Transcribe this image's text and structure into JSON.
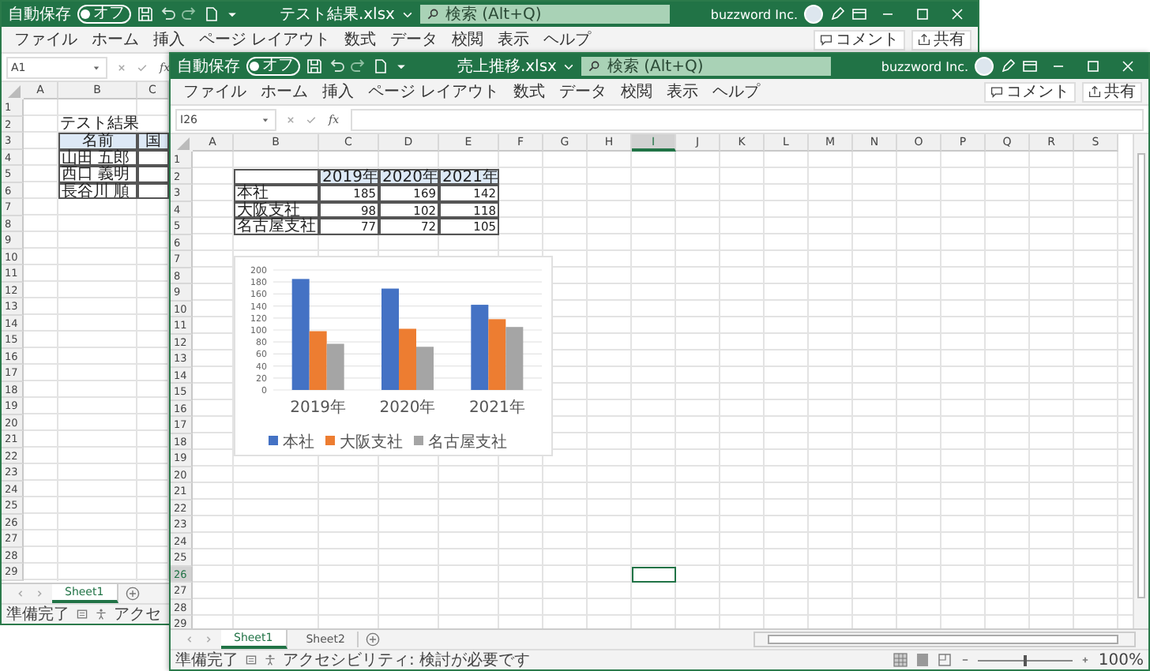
{
  "windows": [
    {
      "autosave": {
        "label": "自動保存",
        "toggle": "オフ",
        "on": false
      },
      "title": "テスト結果.xlsx",
      "search": {
        "placeholder": "検索 (Alt+Q)"
      },
      "account": "buzzword Inc.",
      "ribbon_tabs": [
        "ファイル",
        "ホーム",
        "挿入",
        "ページ レイアウト",
        "数式",
        "データ",
        "校閲",
        "表示",
        "ヘルプ"
      ],
      "comment_button": "コメント",
      "share_button": "共有",
      "name_box": "A1",
      "formula_label": "fx",
      "columns": [
        "A",
        "B",
        "C"
      ],
      "rows": [
        {
          "number": "1"
        },
        {
          "number": "2"
        },
        {
          "number": "3"
        },
        {
          "number": "4"
        },
        {
          "number": "5"
        },
        {
          "number": "6"
        },
        {
          "number": "7"
        },
        {
          "number": "8"
        },
        {
          "number": "9"
        },
        {
          "number": "10"
        },
        {
          "number": "11"
        },
        {
          "number": "12"
        },
        {
          "number": "13"
        },
        {
          "number": "14"
        },
        {
          "number": "15"
        },
        {
          "number": "16"
        },
        {
          "number": "17"
        },
        {
          "number": "18"
        },
        {
          "number": "19"
        },
        {
          "number": "20"
        },
        {
          "number": "21"
        },
        {
          "number": "22"
        },
        {
          "number": "23"
        },
        {
          "number": "24"
        },
        {
          "number": "25"
        },
        {
          "number": "26"
        },
        {
          "number": "27"
        },
        {
          "number": "28"
        },
        {
          "number": "29"
        }
      ],
      "sheet_title": "テスト結果",
      "table": {
        "columns": [
          "名前",
          "国"
        ],
        "rows": [
          {
            "label": "山田 五郎"
          },
          {
            "label": "西口 義明"
          },
          {
            "label": "長谷川 順"
          }
        ]
      },
      "sheet_tabs": [
        {
          "label": "Sheet1",
          "selected": true
        }
      ],
      "status_bar": {
        "ready": "準備完了",
        "accessibility": "アクセ"
      }
    },
    {
      "autosave": {
        "label": "自動保存",
        "toggle": "オフ",
        "on": false
      },
      "title": "売上推移.xlsx",
      "search": {
        "placeholder": "検索 (Alt+Q)"
      },
      "account": "buzzword Inc.",
      "ribbon_tabs": [
        "ファイル",
        "ホーム",
        "挿入",
        "ページ レイアウト",
        "数式",
        "データ",
        "校閲",
        "表示",
        "ヘルプ"
      ],
      "comment_button": "コメント",
      "share_button": "共有",
      "name_box": "I26",
      "formula_label": "fx",
      "columns": [
        {
          "label": "A",
          "selected": false
        },
        {
          "label": "B",
          "selected": false
        },
        {
          "label": "C",
          "selected": false
        },
        {
          "label": "D",
          "selected": false
        },
        {
          "label": "E",
          "selected": false
        },
        {
          "label": "F",
          "selected": false
        },
        {
          "label": "G",
          "selected": false
        },
        {
          "label": "H",
          "selected": false
        },
        {
          "label": "I",
          "selected": true
        },
        {
          "label": "J",
          "selected": false
        },
        {
          "label": "K",
          "selected": false
        },
        {
          "label": "L",
          "selected": false
        },
        {
          "label": "M",
          "selected": false
        },
        {
          "label": "N",
          "selected": false
        },
        {
          "label": "O",
          "selected": false
        },
        {
          "label": "P",
          "selected": false
        },
        {
          "label": "Q",
          "selected": false
        },
        {
          "label": "R",
          "selected": false
        },
        {
          "label": "S",
          "selected": false
        }
      ],
      "rows": [
        {
          "number": "1",
          "selected": false
        },
        {
          "number": "2",
          "selected": false
        },
        {
          "number": "3",
          "selected": false
        },
        {
          "number": "4",
          "selected": false
        },
        {
          "number": "5",
          "selected": false
        },
        {
          "number": "6",
          "selected": false
        },
        {
          "number": "7",
          "selected": false
        },
        {
          "number": "8",
          "selected": false
        },
        {
          "number": "9",
          "selected": false
        },
        {
          "number": "10",
          "selected": false
        },
        {
          "number": "11",
          "selected": false
        },
        {
          "number": "12",
          "selected": false
        },
        {
          "number": "13",
          "selected": false
        },
        {
          "number": "14",
          "selected": false
        },
        {
          "number": "15",
          "selected": false
        },
        {
          "number": "16",
          "selected": false
        },
        {
          "number": "17",
          "selected": false
        },
        {
          "number": "18",
          "selected": false
        },
        {
          "number": "19",
          "selected": false
        },
        {
          "number": "20",
          "selected": false
        },
        {
          "number": "21",
          "selected": false
        },
        {
          "number": "22",
          "selected": false
        },
        {
          "number": "23",
          "selected": false
        },
        {
          "number": "24",
          "selected": false
        },
        {
          "number": "25",
          "selected": false
        },
        {
          "number": "26",
          "selected": true
        },
        {
          "number": "27",
          "selected": false
        },
        {
          "number": "28",
          "selected": false
        },
        {
          "number": "29",
          "selected": false
        }
      ],
      "table": {
        "columns": [
          "2019年",
          "2020年",
          "2021年"
        ],
        "rows": [
          {
            "label": "本社",
            "values": [
              "185",
              "169",
              "142"
            ]
          },
          {
            "label": "大阪支社",
            "values": [
              "98",
              "102",
              "118"
            ]
          },
          {
            "label": "名古屋支社",
            "values": [
              "77",
              "72",
              "105"
            ]
          }
        ]
      },
      "chart_data": {
        "type": "bar",
        "categories": [
          "2019年",
          "2020年",
          "2021年"
        ],
        "series": [
          {
            "name": "本社",
            "color": "#4472c4",
            "values": [
              185,
              169,
              142
            ]
          },
          {
            "name": "大阪支社",
            "color": "#ed7d31",
            "values": [
              98,
              102,
              118
            ]
          },
          {
            "name": "名古屋支社",
            "color": "#a5a5a5",
            "values": [
              77,
              72,
              105
            ]
          }
        ],
        "grid": true,
        "legend": true,
        "ylim": [
          0,
          200
        ],
        "yticks": [
          0,
          20,
          40,
          60,
          80,
          100,
          120,
          140,
          160,
          180,
          200
        ]
      },
      "sheet_tabs": [
        {
          "label": "Sheet1",
          "selected": true
        },
        {
          "label": "Sheet2",
          "selected": false
        }
      ],
      "status_bar": {
        "ready": "準備完了",
        "accessibility": "アクセシビリティ: 検討が必要です",
        "zoom": "100%"
      },
      "zoom_slider": {
        "level": 0.5
      }
    }
  ]
}
